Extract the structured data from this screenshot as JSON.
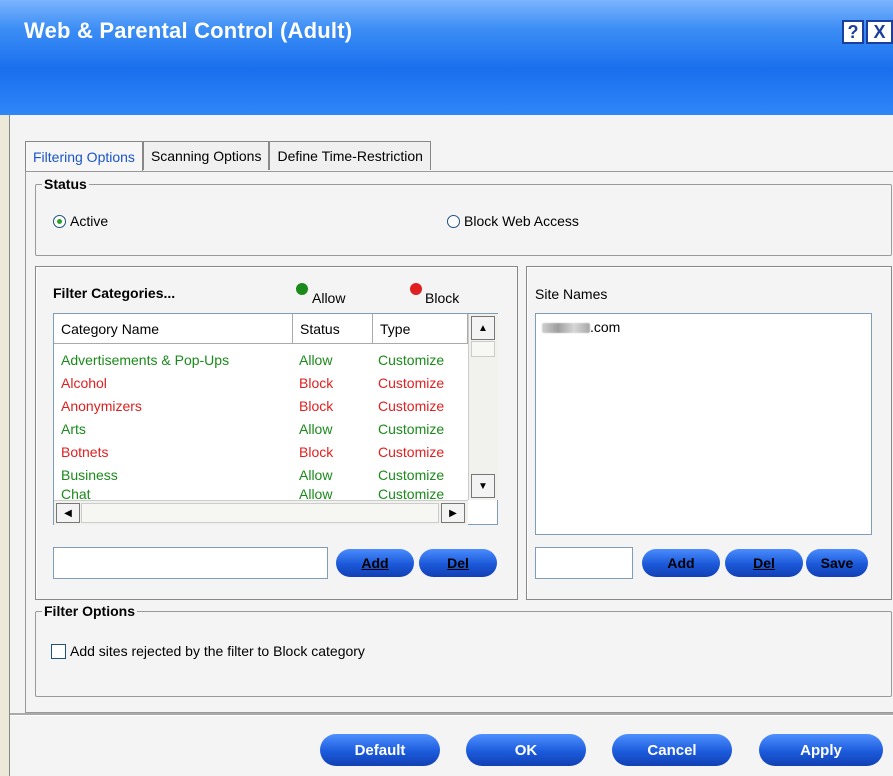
{
  "window": {
    "title": "Web & Parental Control (Adult)",
    "help_label": "?",
    "close_label": "X"
  },
  "tabs": [
    {
      "label": "Filtering Options",
      "active": true
    },
    {
      "label": "Scanning Options",
      "active": false
    },
    {
      "label": "Define Time-Restriction",
      "active": false
    }
  ],
  "status": {
    "legend": "Status",
    "options": [
      {
        "label": "Active",
        "selected": true
      },
      {
        "label": "Block Web Access",
        "selected": false
      }
    ]
  },
  "filter_categories": {
    "title": "Filter Categories...",
    "legend_allow": "Allow",
    "legend_block": "Block",
    "allow_color": "#1a8a1a",
    "block_color": "#e02020",
    "columns": [
      "Category Name",
      "Status",
      "Type"
    ],
    "rows": [
      {
        "name": "Advertisements & Pop-Ups",
        "status": "Allow",
        "type": "Customize"
      },
      {
        "name": "Alcohol",
        "status": "Block",
        "type": "Customize"
      },
      {
        "name": "Anonymizers",
        "status": "Block",
        "type": "Customize"
      },
      {
        "name": "Arts",
        "status": "Allow",
        "type": "Customize"
      },
      {
        "name": "Botnets",
        "status": "Block",
        "type": "Customize"
      },
      {
        "name": "Business",
        "status": "Allow",
        "type": "Customize"
      },
      {
        "name": "Chat",
        "status": "Allow",
        "type": "Customize"
      }
    ],
    "input_value": "",
    "add_label": "Add",
    "del_label": "Del"
  },
  "site_names": {
    "title": "Site Names",
    "items": [
      ".com"
    ],
    "input_value": "",
    "add_label": "Add",
    "del_label": "Del",
    "save_label": "Save"
  },
  "filter_options": {
    "legend": "Filter Options",
    "checkbox_label": "Add sites rejected by the filter to Block category",
    "checked": false
  },
  "footer": {
    "default_label": "Default",
    "ok_label": "OK",
    "cancel_label": "Cancel",
    "apply_label": "Apply"
  }
}
